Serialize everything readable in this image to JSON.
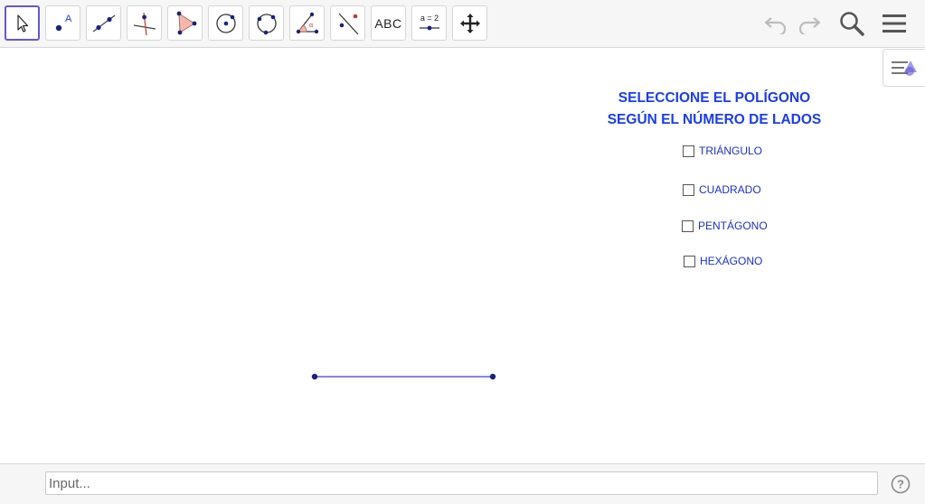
{
  "toolbar": {
    "tools": [
      {
        "name": "move-tool",
        "icon": "arrow-cursor-icon"
      },
      {
        "name": "point-tool",
        "icon": "point-icon",
        "glyph": "A"
      },
      {
        "name": "line-tool",
        "icon": "line-icon"
      },
      {
        "name": "perpendicular-line-tool",
        "icon": "perpendicular-icon"
      },
      {
        "name": "polygon-tool",
        "icon": "polygon-icon"
      },
      {
        "name": "circle-center-point-tool",
        "icon": "circle-center-icon"
      },
      {
        "name": "circle-three-points-tool",
        "icon": "circle-three-points-icon"
      },
      {
        "name": "angle-tool",
        "icon": "angle-icon",
        "glyph": "α"
      },
      {
        "name": "reflect-tool",
        "icon": "reflect-icon"
      },
      {
        "name": "text-tool",
        "icon": "text-icon",
        "label": "ABC"
      },
      {
        "name": "slider-tool",
        "icon": "slider-icon",
        "label": "a = 2"
      },
      {
        "name": "move-graphics-tool",
        "icon": "move-arrows-icon"
      }
    ],
    "right_icons": [
      "undo-icon",
      "redo-icon",
      "search-icon",
      "menu-icon"
    ]
  },
  "graphics": {
    "heading_line1": "SELECCIONE EL POLÍGONO",
    "heading_line2": "SEGÚN EL NÚMERO DE LADOS",
    "checkboxes": [
      {
        "label": "TRIÁNGULO",
        "checked": false
      },
      {
        "label": "CUADRADO",
        "checked": false
      },
      {
        "label": "PENTÁGONO",
        "checked": false
      },
      {
        "label": "HEXÁGONO",
        "checked": false
      }
    ],
    "style_bar_icon": "style-bar-toggle-icon"
  },
  "input_bar": {
    "placeholder": "Input...",
    "value": "",
    "help_icon": "help-icon"
  },
  "colors": {
    "accent": "#6557d2",
    "heading_text": "#1a3cf0",
    "label_text": "#1c2fd0",
    "segment": "#5a5ae6",
    "point": "#1a237e"
  }
}
